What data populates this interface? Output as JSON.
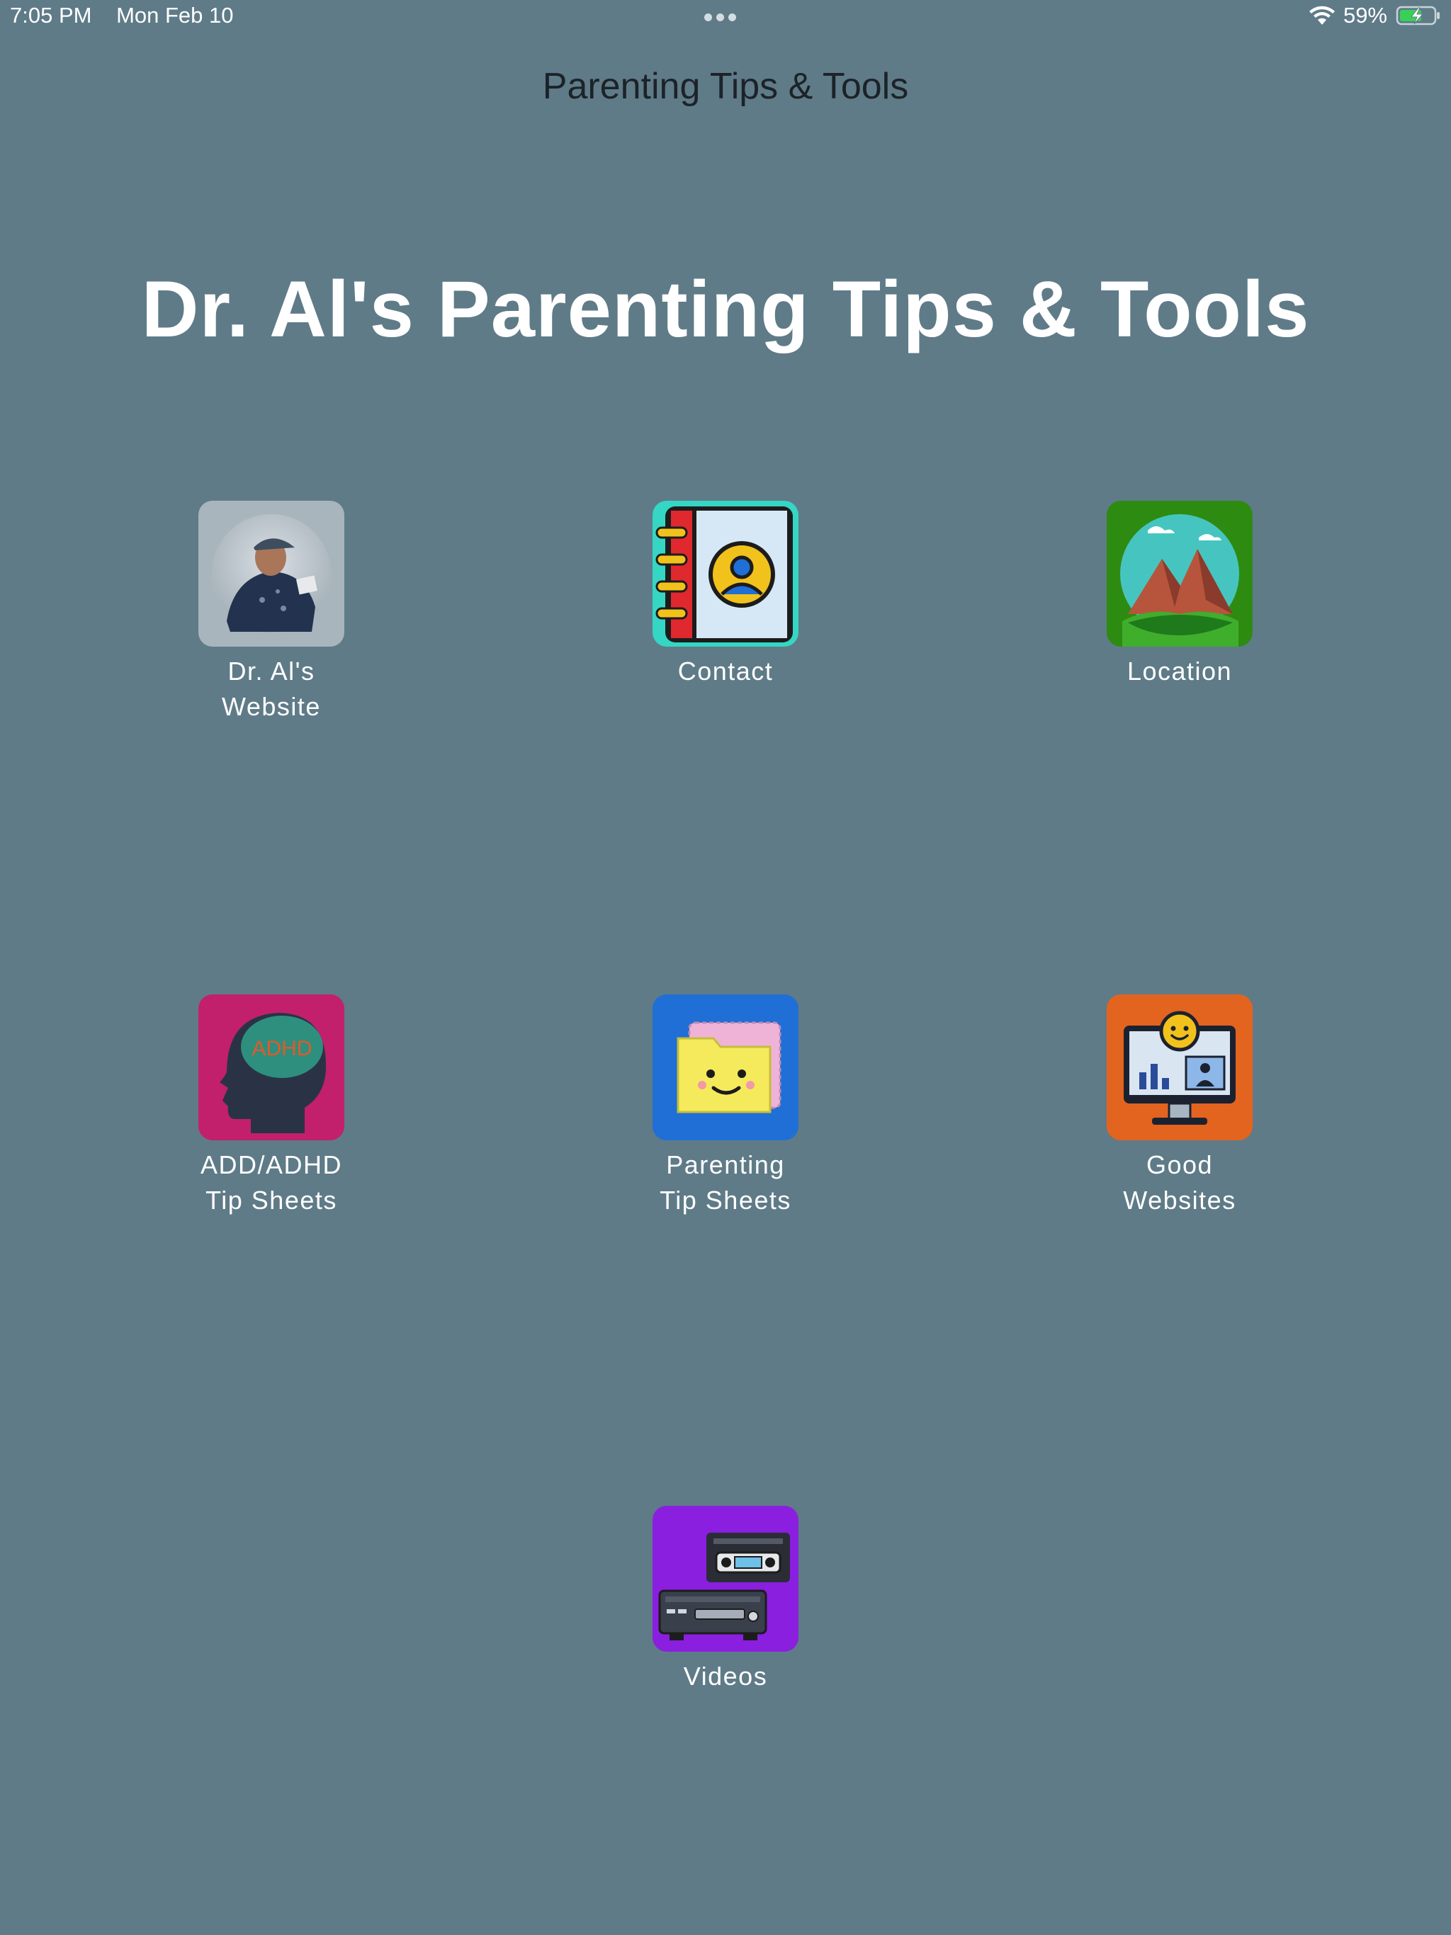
{
  "status_bar": {
    "time": "7:05 PM",
    "date": "Mon Feb 10",
    "battery": "59%",
    "icons": [
      "wifi-icon",
      "battery-charging-icon"
    ]
  },
  "nav": {
    "title": "Parenting Tips & Tools"
  },
  "hero": {
    "title": "Dr. Al's Parenting Tips & Tools"
  },
  "tiles": [
    {
      "line1": "Dr. Al's",
      "line2": "Website",
      "icon": "profile-photo-icon"
    },
    {
      "line1": "Contact",
      "line2": "",
      "icon": "address-book-icon"
    },
    {
      "line1": "Location",
      "line2": "",
      "icon": "mountain-landscape-icon"
    },
    {
      "line1": "ADD/ADHD",
      "line2": "Tip Sheets",
      "icon": "adhd-head-icon",
      "icon_text": "ADHD"
    },
    {
      "line1": "Parenting",
      "line2": "Tip Sheets",
      "icon": "smiley-folder-icon"
    },
    {
      "line1": "Good",
      "line2": "Websites",
      "icon": "monitor-dashboard-icon"
    },
    {
      "line1": "Videos",
      "line2": "",
      "icon": "vcr-cassette-icon"
    }
  ],
  "colors": {
    "background": "#5f7b88",
    "website_icon": "#a9b5bd",
    "contact_icon": "#35d6c4",
    "location_icon": "#2e8b11",
    "adhd_icon": "#c2206c",
    "parenting_icon": "#1f6fd6",
    "websites_icon": "#e3641f",
    "videos_icon": "#8a1fe0"
  }
}
